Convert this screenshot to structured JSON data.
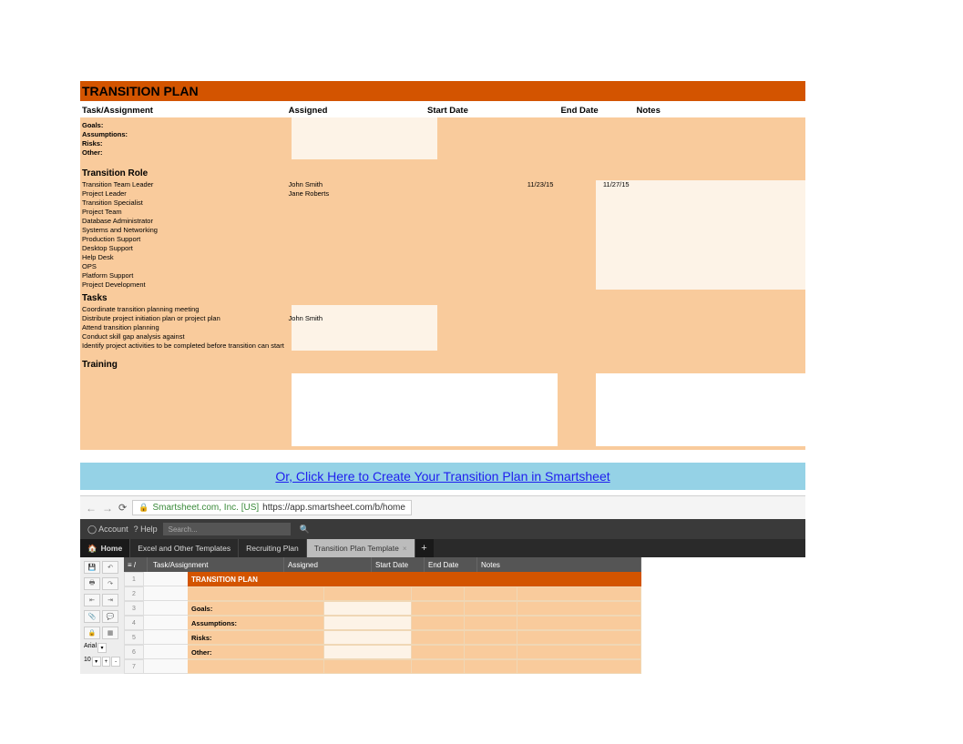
{
  "plan": {
    "title": "TRANSITION PLAN",
    "headers": {
      "task": "Task/Assignment",
      "assigned": "Assigned",
      "start": "Start Date",
      "end": "End Date",
      "notes": "Notes"
    },
    "intro_labels": {
      "goals": "Goals:",
      "assumptions": "Assumptions:",
      "risks": "Risks:",
      "other": "Other:"
    },
    "role_section": "Transition Role",
    "roles": [
      {
        "name": "Transition Team Leader",
        "assigned": "John Smith",
        "start": "11/23/15",
        "end": "11/27/15"
      },
      {
        "name": "Project Leader",
        "assigned": "Jane Roberts",
        "start": "",
        "end": ""
      },
      {
        "name": "Transition Specialist",
        "assigned": "",
        "start": "",
        "end": ""
      },
      {
        "name": "Project Team",
        "assigned": "",
        "start": "",
        "end": ""
      },
      {
        "name": "Database Administrator",
        "assigned": "",
        "start": "",
        "end": ""
      },
      {
        "name": "Systems and Networking",
        "assigned": "",
        "start": "",
        "end": ""
      },
      {
        "name": "Production Support",
        "assigned": "",
        "start": "",
        "end": ""
      },
      {
        "name": "Desktop Support",
        "assigned": "",
        "start": "",
        "end": ""
      },
      {
        "name": "Help Desk",
        "assigned": "",
        "start": "",
        "end": ""
      },
      {
        "name": "OPS",
        "assigned": "",
        "start": "",
        "end": ""
      },
      {
        "name": "Platform Support",
        "assigned": "",
        "start": "",
        "end": ""
      },
      {
        "name": "Project Development",
        "assigned": "",
        "start": "",
        "end": ""
      }
    ],
    "tasks_section": "Tasks",
    "tasks": [
      {
        "name": "Coordinate transition planning meeting",
        "assigned": ""
      },
      {
        "name": "Distribute project initiation plan or project plan",
        "assigned": "John Smith"
      },
      {
        "name": "Attend transition planning",
        "assigned": ""
      },
      {
        "name": "Conduct skill gap analysis against",
        "assigned": ""
      },
      {
        "name": "Identify project activities to be completed before transition can start",
        "assigned": ""
      }
    ],
    "training_section": "Training"
  },
  "cta": {
    "text": "Or, Click Here to Create Your Transition Plan in Smartsheet"
  },
  "browser": {
    "identity": "Smartsheet.com, Inc. [US]",
    "url": "https://app.smartsheet.com/b/home",
    "top_bar": {
      "account": "Account",
      "help": "? Help",
      "search_placeholder": "Search..."
    },
    "tabs": {
      "home": "Home",
      "t1": "Excel and Other Templates",
      "t2": "Recruiting Plan",
      "t3": "Transition Plan Template"
    },
    "toolbar_font": {
      "label": "Arial",
      "size": "10"
    },
    "columns": {
      "task": "Task/Assignment",
      "assigned": "Assigned",
      "start": "Start Date",
      "end": "End Date",
      "notes": "Notes"
    },
    "rows": [
      {
        "n": "1",
        "type": "title",
        "task": "TRANSITION PLAN"
      },
      {
        "n": "2",
        "type": "blank",
        "task": ""
      },
      {
        "n": "3",
        "type": "data",
        "task": "Goals:"
      },
      {
        "n": "4",
        "type": "data",
        "task": "Assumptions:"
      },
      {
        "n": "5",
        "type": "data",
        "task": "Risks:"
      },
      {
        "n": "6",
        "type": "data",
        "task": "Other:"
      },
      {
        "n": "7",
        "type": "blank",
        "task": ""
      }
    ]
  }
}
